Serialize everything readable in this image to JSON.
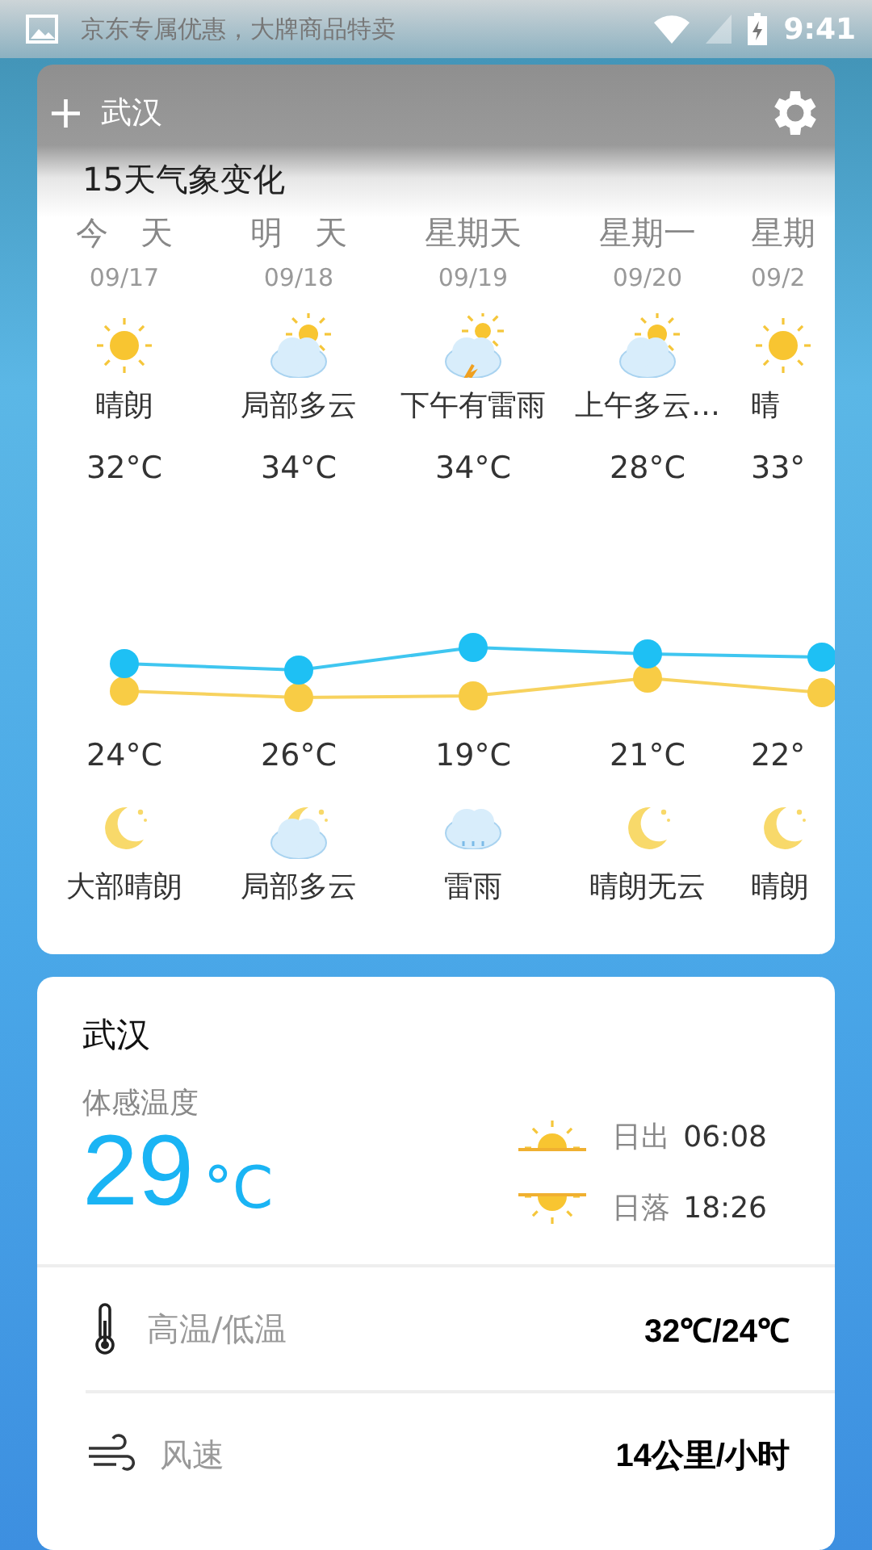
{
  "status_bar": {
    "notification": "京东专属优惠，大牌商品特卖",
    "time": "9:41"
  },
  "header": {
    "add": "+",
    "city": "武汉"
  },
  "forecast": {
    "title": "15天气象变化",
    "days": [
      {
        "day": "今　天",
        "date": "09/17",
        "daytime": {
          "kind": "sunny",
          "condition": "晴朗",
          "temperature": "32°C"
        },
        "night": {
          "kind": "night_clear",
          "condition": "大部晴朗",
          "temperature": "24°C"
        }
      },
      {
        "day": "明　天",
        "date": "09/18",
        "daytime": {
          "kind": "partly_cloudy",
          "condition": "局部多云",
          "temperature": "34°C"
        },
        "night": {
          "kind": "night_cloudy",
          "condition": "局部多云",
          "temperature": "26°C"
        }
      },
      {
        "day": "星期天",
        "date": "09/19",
        "daytime": {
          "kind": "thunder",
          "condition": "下午有雷雨",
          "temperature": "34°C"
        },
        "night": {
          "kind": "rain",
          "condition": "雷雨",
          "temperature": "19°C"
        }
      },
      {
        "day": "星期一",
        "date": "09/20",
        "daytime": {
          "kind": "partly_cloudy",
          "condition": "上午多云…",
          "temperature": "28°C"
        },
        "night": {
          "kind": "night_clear",
          "condition": "晴朗无云",
          "temperature": "21°C"
        }
      },
      {
        "day": "星期",
        "date": "09/2",
        "daytime": {
          "kind": "sunny",
          "condition": "晴",
          "temperature": "33°"
        },
        "night": {
          "kind": "night_clear",
          "condition": "晴朗",
          "temperature": "22°"
        }
      }
    ]
  },
  "today": {
    "city": "武汉",
    "feels_like_label": "体感温度",
    "feels_like": "29",
    "unit": "°C",
    "sunrise_label": "日出",
    "sunrise": "06:08",
    "sunset_label": "日落",
    "sunset": "18:26",
    "rows": [
      {
        "kind": "thermometer",
        "label": "高温/低温",
        "value": "32℃/24℃"
      },
      {
        "kind": "wind",
        "label": "风速",
        "value": "14公里/小时"
      }
    ]
  }
}
